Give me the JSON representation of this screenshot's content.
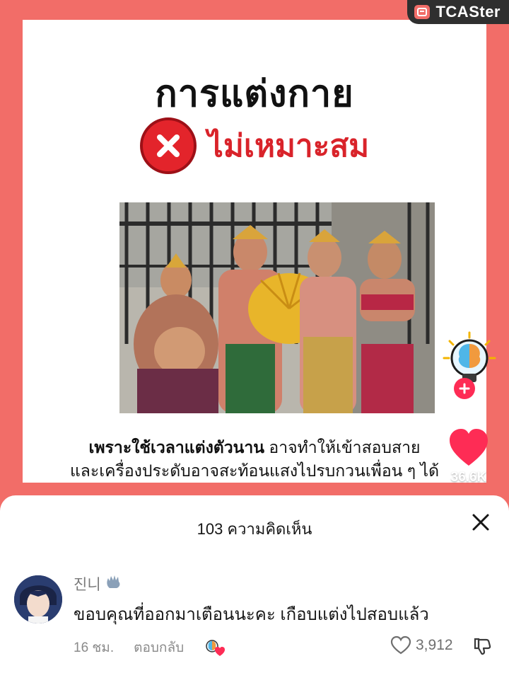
{
  "watermark": {
    "brand": "TCASter",
    "logo_icon": "tcaster-logo-icon"
  },
  "post": {
    "headline": "การแต่งกาย",
    "verdict": "ไม่เหมาะสม",
    "verdict_icon": "x-cross-icon",
    "caption_bold": "เพราะใช้เวลาแต่งตัวนาน",
    "caption_rest": " อาจทำให้เข้าสอบสาย",
    "caption_line2": "และเครื่องประดับอาจสะท้อนแสงไปรบกวนเพื่อน ๆ ได้"
  },
  "actions": {
    "follow_icon": "plus-icon",
    "profile_icon": "lightbulb-brain-icon",
    "like_icon": "heart-icon",
    "like_count": "36.6K"
  },
  "comments": {
    "title": "103 ความคิดเห็น",
    "close_icon": "close-icon",
    "items": [
      {
        "username": "진니",
        "username_emoji": "waving-hand-icon",
        "text": "ขอบคุณที่ออกมาเตือนนะคะ เกือบแต่งไปสอบแล้ว",
        "time": "16 ชม.",
        "reply_label": "ตอบกลับ",
        "likes": "3,912"
      }
    ]
  },
  "colors": {
    "accent": "#f26d68",
    "verdict_red": "#e3242b",
    "like_pink": "#fe2c55"
  }
}
